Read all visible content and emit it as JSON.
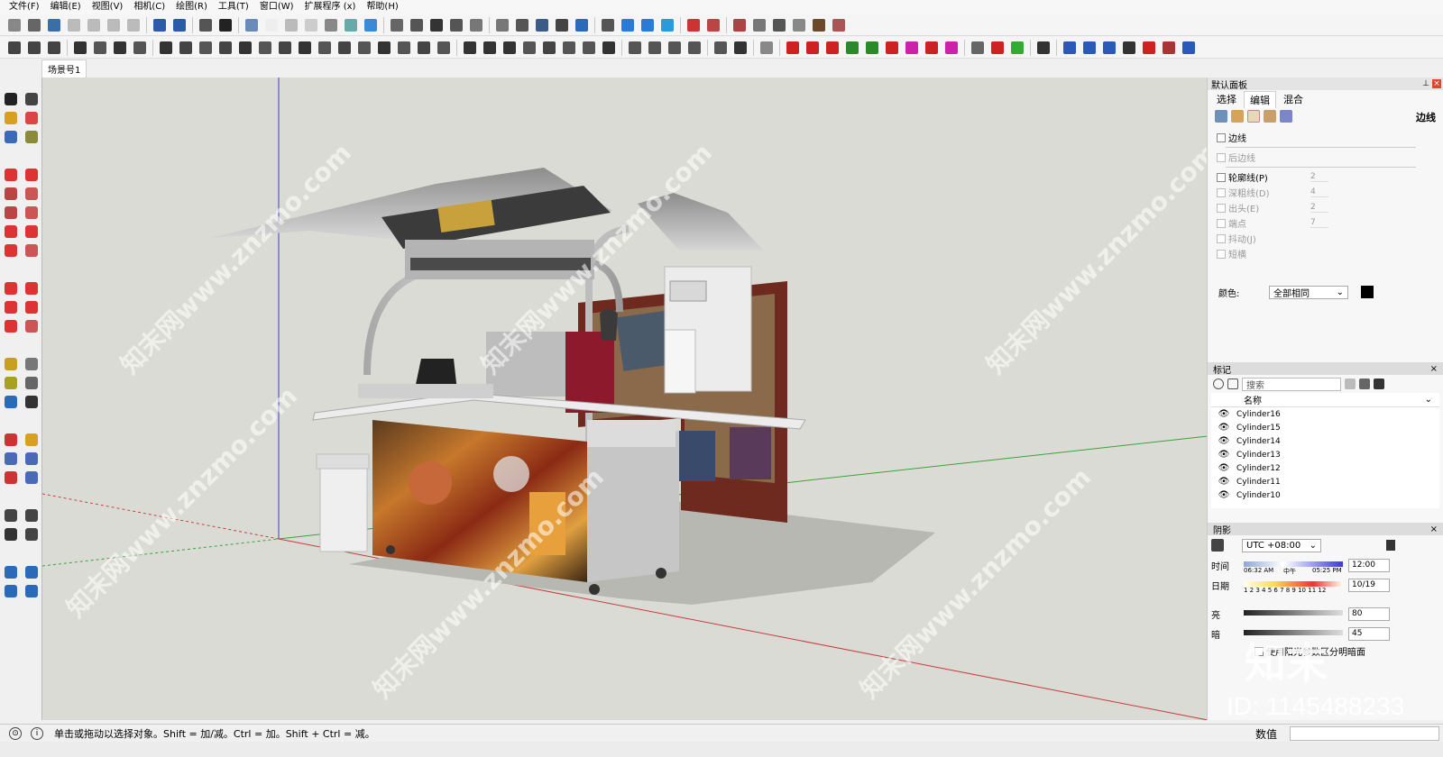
{
  "menu": [
    "文件(F)",
    "编辑(E)",
    "视图(V)",
    "相机(C)",
    "绘图(R)",
    "工具(T)",
    "窗口(W)",
    "扩展程序 (x)",
    "帮助(H)"
  ],
  "scene_tab": "场景号1",
  "panel": {
    "title": "默认面板",
    "tabs": [
      "选择",
      "编辑",
      "混合"
    ],
    "active_tab": "编辑",
    "section_label": "边线",
    "edge_options": [
      {
        "label": "边线",
        "checked": false,
        "enabled": true,
        "value": ""
      },
      {
        "label": "后边线",
        "checked": false,
        "enabled": false,
        "value": ""
      },
      {
        "label": "轮廓线(P)",
        "checked": false,
        "enabled": true,
        "value": "2"
      },
      {
        "label": "深粗线(D)",
        "checked": false,
        "enabled": false,
        "value": "4"
      },
      {
        "label": "出头(E)",
        "checked": false,
        "enabled": false,
        "value": "2"
      },
      {
        "label": "端点",
        "checked": false,
        "enabled": false,
        "value": "7"
      },
      {
        "label": "抖动(J)",
        "checked": false,
        "enabled": false,
        "value": ""
      },
      {
        "label": "短横",
        "checked": false,
        "enabled": false,
        "value": ""
      }
    ],
    "color_label": "颜色:",
    "color_value": "全部相同",
    "tags": {
      "title": "标记",
      "search_placeholder": "搜索",
      "column": "名称",
      "items": [
        "Cylinder16",
        "Cylinder15",
        "Cylinder14",
        "Cylinder13",
        "Cylinder12",
        "Cylinder11",
        "Cylinder10"
      ]
    },
    "shadow": {
      "title": "阴影",
      "timezone": "UTC +08:00",
      "time_label": "时间",
      "time_start": "06:32 AM",
      "time_mid": "中午",
      "time_end": "05:25 PM",
      "time_value": "12:00",
      "date_label": "日期",
      "months": "1 2 3 4 5 6 7 8 9 10 11 12",
      "date_value": "10/19",
      "light_label": "亮",
      "light_value": "80",
      "dark_label": "暗",
      "dark_value": "45",
      "sun_option": "使用阳光参数区分明暗面"
    }
  },
  "status": {
    "message": "单击或拖动以选择对象。Shift = 加/减。Ctrl = 加。Shift + Ctrl = 减。",
    "measure_label": "数值"
  },
  "watermark": {
    "text": "知末网www.znzmo.com",
    "logo": "知末",
    "id": "ID: 1145488233"
  },
  "colors": {
    "viewport_bg": "#dbdbd6",
    "red_axis": "#c83c3c",
    "green_axis": "#3ca03c",
    "blue_axis": "#3c3cc8",
    "kiosk_back": "#6e2a1e",
    "metal": "#c9c9c9"
  }
}
